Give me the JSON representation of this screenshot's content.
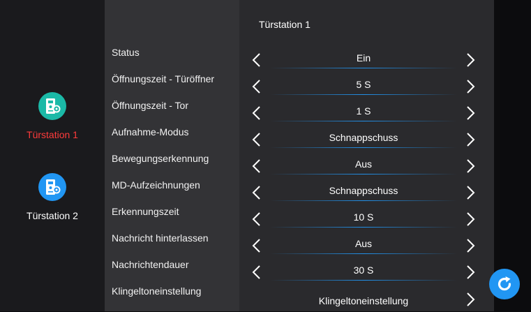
{
  "title": "Türstation 1",
  "colors": {
    "accent": "#2196f3",
    "active_device_text": "#ff3b3b",
    "device1_icon": "#1bb9a7",
    "device2_icon": "#2196f3"
  },
  "devices": [
    {
      "name": "Türstation 1",
      "icon": "doorbell-settings-icon",
      "active": true
    },
    {
      "name": "Türstation 2",
      "icon": "doorbell-settings-icon",
      "active": false
    }
  ],
  "settings": [
    {
      "label": "Status",
      "value": "Ein"
    },
    {
      "label": "Öffnungszeit - Türöffner",
      "value": "5 S"
    },
    {
      "label": "Öffnungszeit - Tor",
      "value": "1 S"
    },
    {
      "label": "Aufnahme-Modus",
      "value": "Schnappschuss"
    },
    {
      "label": "Bewegungserkennung",
      "value": "Aus"
    },
    {
      "label": "MD-Aufzeichnungen",
      "value": "Schnappschuss"
    },
    {
      "label": "Erkennungszeit",
      "value": "10 S"
    },
    {
      "label": "Nachricht hinterlassen",
      "value": "Aus"
    },
    {
      "label": "Nachrichtendauer",
      "value": "30 S"
    },
    {
      "label": "Klingeltoneinstellung",
      "value": "Klingeltoneinstellung"
    }
  ],
  "icons": {
    "prev": "chevron-left-icon",
    "next": "chevron-right-icon",
    "refresh": "refresh-icon"
  }
}
